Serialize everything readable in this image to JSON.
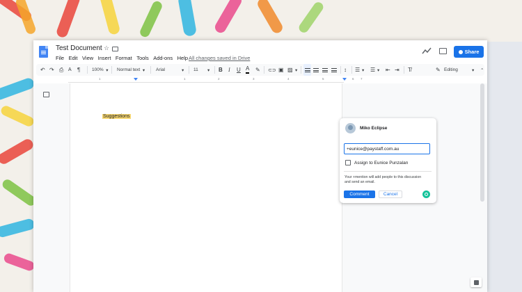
{
  "document": {
    "title": "Test Document",
    "saved_status": "All changes saved in Drive"
  },
  "menu": [
    "File",
    "Edit",
    "View",
    "Insert",
    "Format",
    "Tools",
    "Add-ons",
    "Help"
  ],
  "share_label": "Share",
  "toolbar": {
    "zoom": "100%",
    "style": "Normal text",
    "font": "Arial",
    "font_size": "11",
    "mode": "Editing"
  },
  "ruler": [
    "1",
    "1",
    "2",
    "3",
    "4",
    "5",
    "6",
    "7"
  ],
  "content": {
    "highlighted_text": "Suggestions"
  },
  "comment": {
    "author": "Miko Eclipse",
    "input_value": "+eunice@paystaff.com.au",
    "assign_label": "Assign to Eunice Punzalan",
    "note": "Your +mention will add people to this discussion and send an email.",
    "comment_label": "Comment",
    "cancel_label": "Cancel"
  },
  "colors": {
    "accent": "#1a73e8",
    "highlight": "#f6d66f",
    "grammarly": "#15c39a"
  }
}
